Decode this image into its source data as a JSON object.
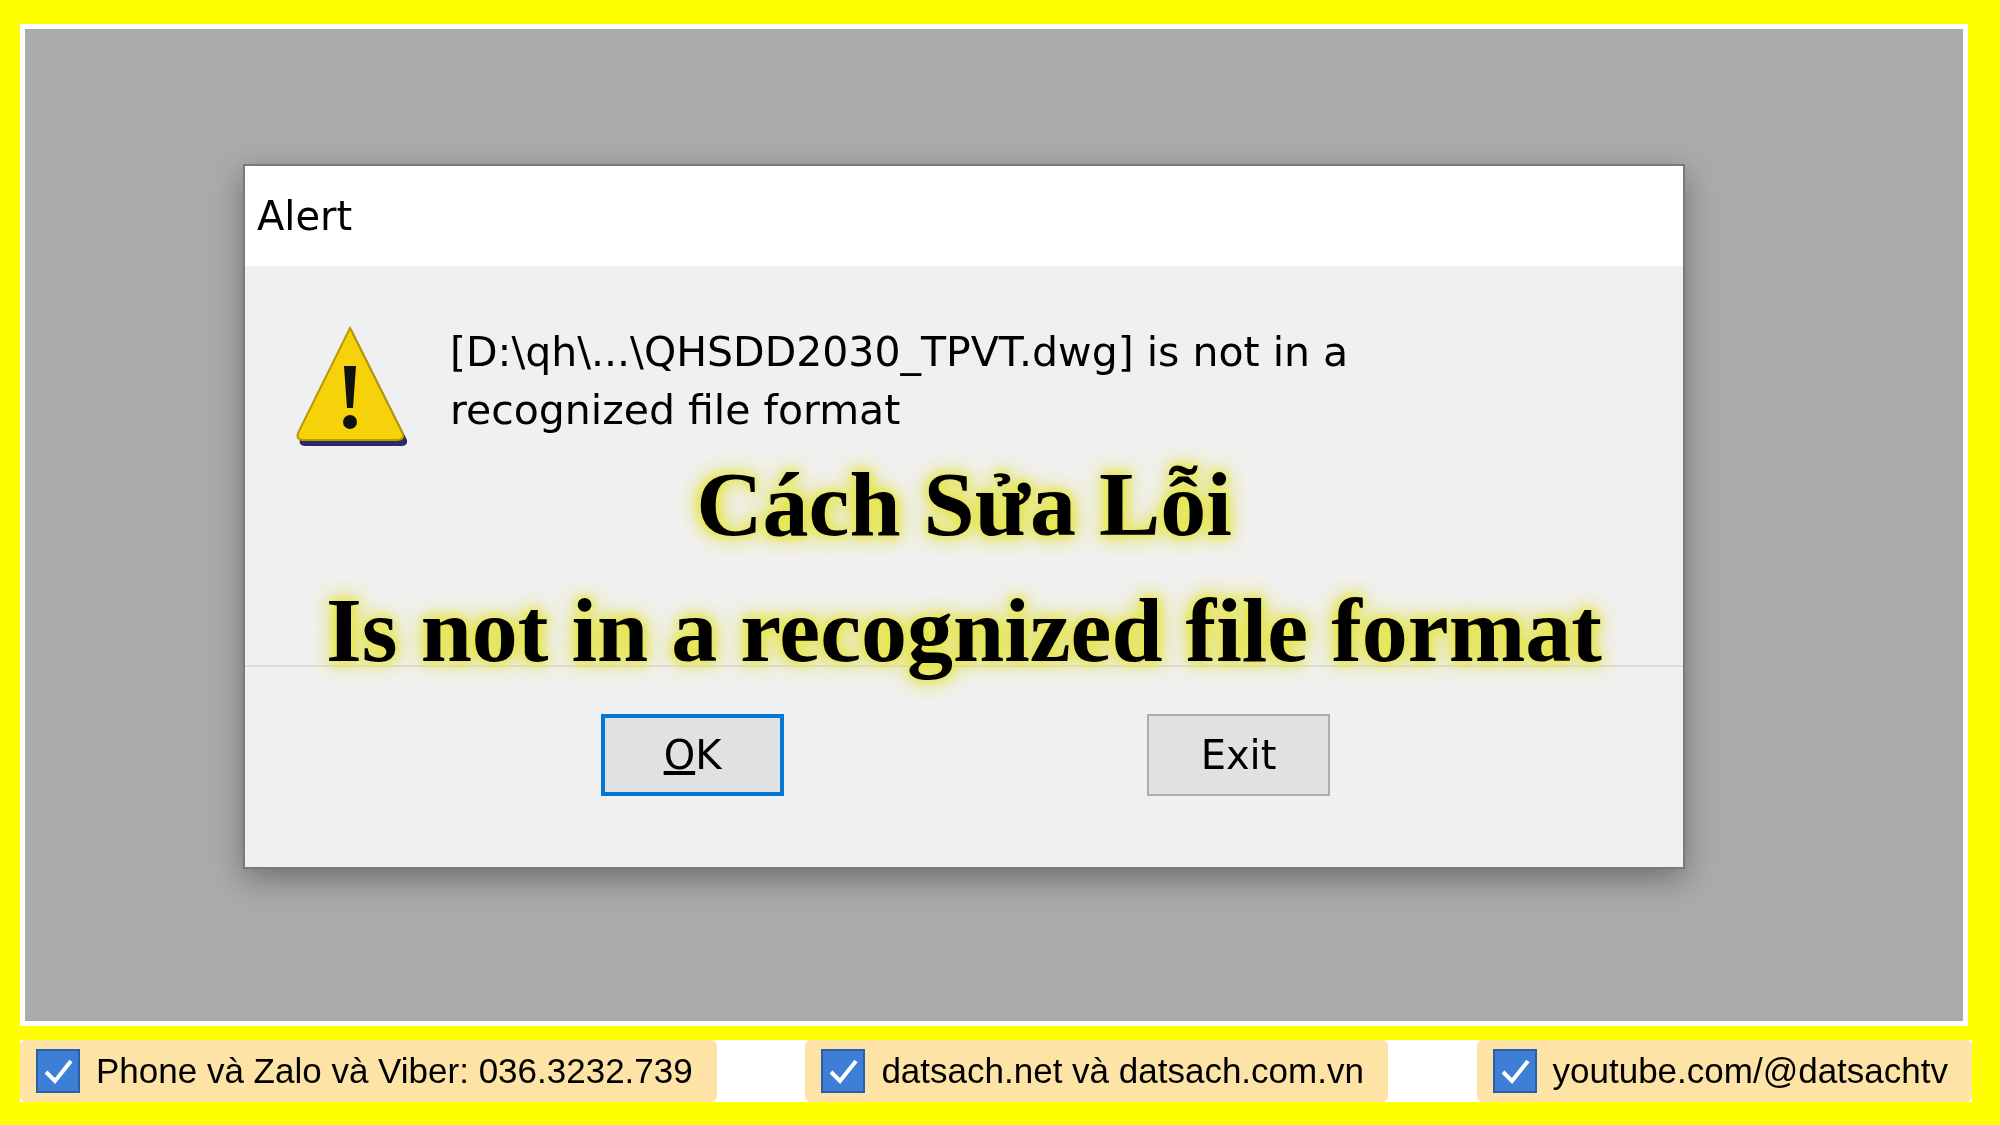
{
  "dialog": {
    "title": "Alert",
    "message": "[D:\\qh\\...\\QHSDD2030_TPVT.dwg] is not in a recognized file format",
    "buttons": [
      {
        "label": "OK",
        "selected": true
      },
      {
        "label": "Exit",
        "selected": false
      }
    ]
  },
  "headline": [
    "Cách Sửa Lỗi",
    "Is not in a recognized file format"
  ],
  "footer": [
    {
      "text": "Phone và Zalo và Viber: 036.3232.739",
      "checked": true
    },
    {
      "text": "datsach.net và datsach.com.vn",
      "checked": true
    },
    {
      "text": "youtube.com/@datsachtv",
      "checked": true
    }
  ]
}
